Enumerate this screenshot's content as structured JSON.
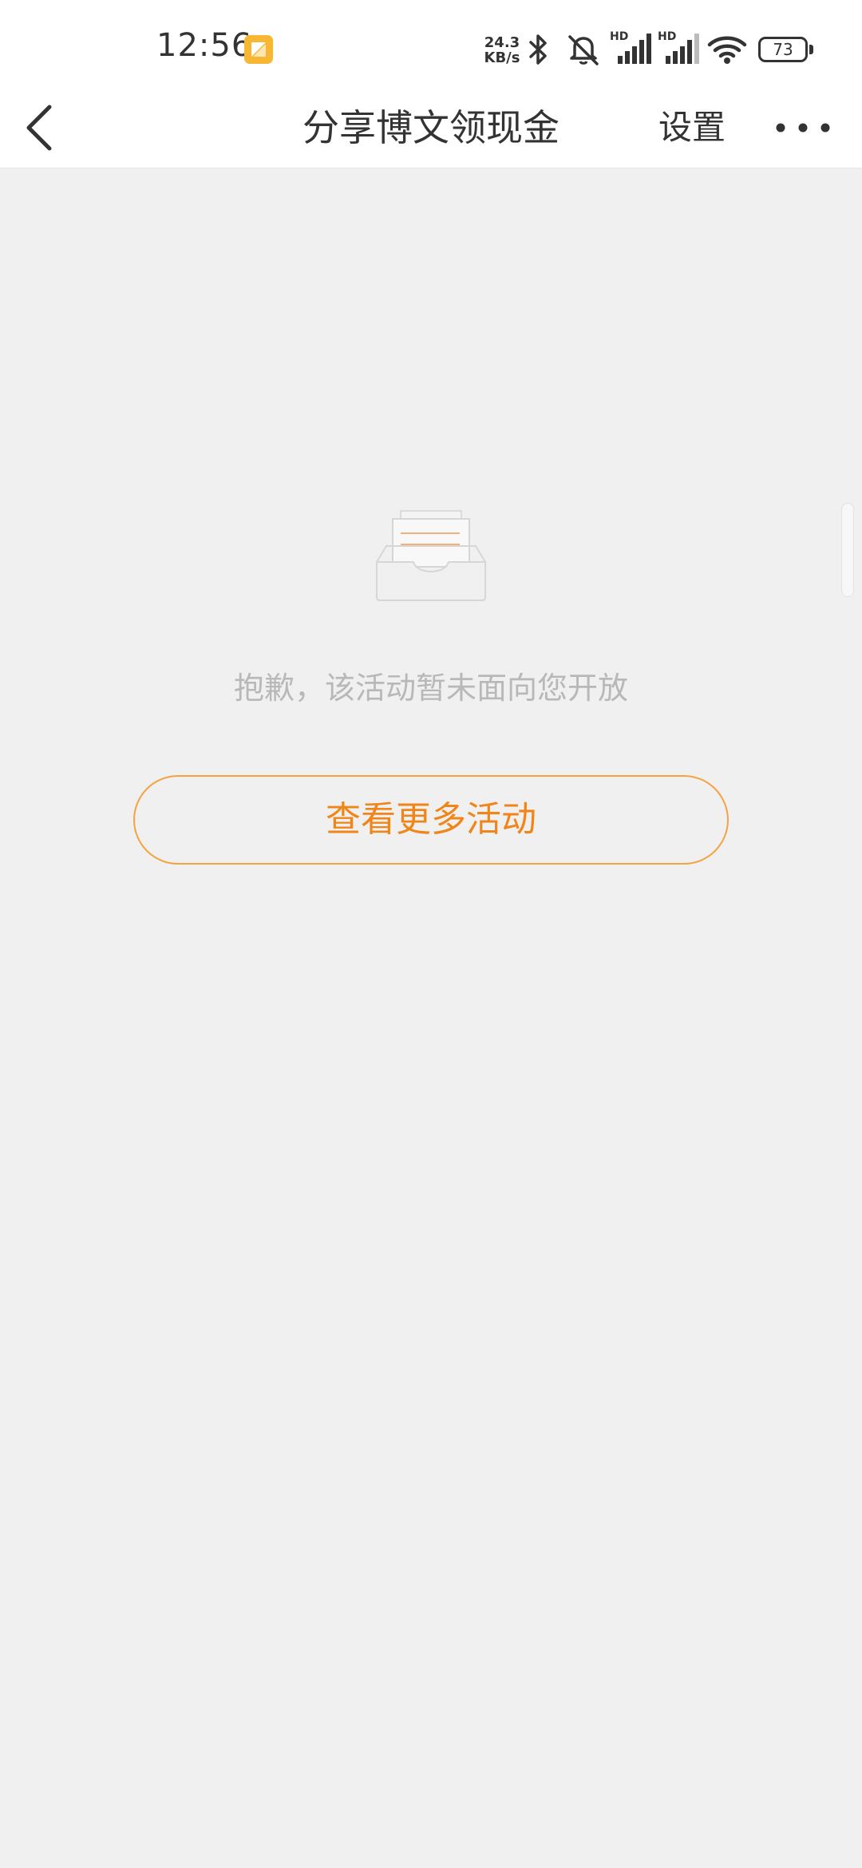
{
  "status_bar": {
    "time": "12:56",
    "net_speed_value": "24.3",
    "net_speed_unit": "KB/s",
    "signal_1_label": "HD",
    "signal_2_label": "HD",
    "battery": "73",
    "icons": [
      "notification-app-icon",
      "bluetooth-icon",
      "mute-icon",
      "signal-icon",
      "signal-icon",
      "wifi-icon",
      "battery-icon"
    ]
  },
  "nav": {
    "back_icon": "chevron-left-icon",
    "title": "分享博文领现金",
    "settings_label": "设置",
    "more_icon": "more-dots-icon"
  },
  "content": {
    "illustration_icon": "empty-inbox-icon",
    "empty_message": "抱歉，该活动暂未面向您开放",
    "more_activities_label": "查看更多活动"
  },
  "colors": {
    "background": "#f0f0f0",
    "accent": "#f08519",
    "button_border": "#f5a243",
    "message_text": "#b8b8b8",
    "bar_background": "#ffffff"
  }
}
